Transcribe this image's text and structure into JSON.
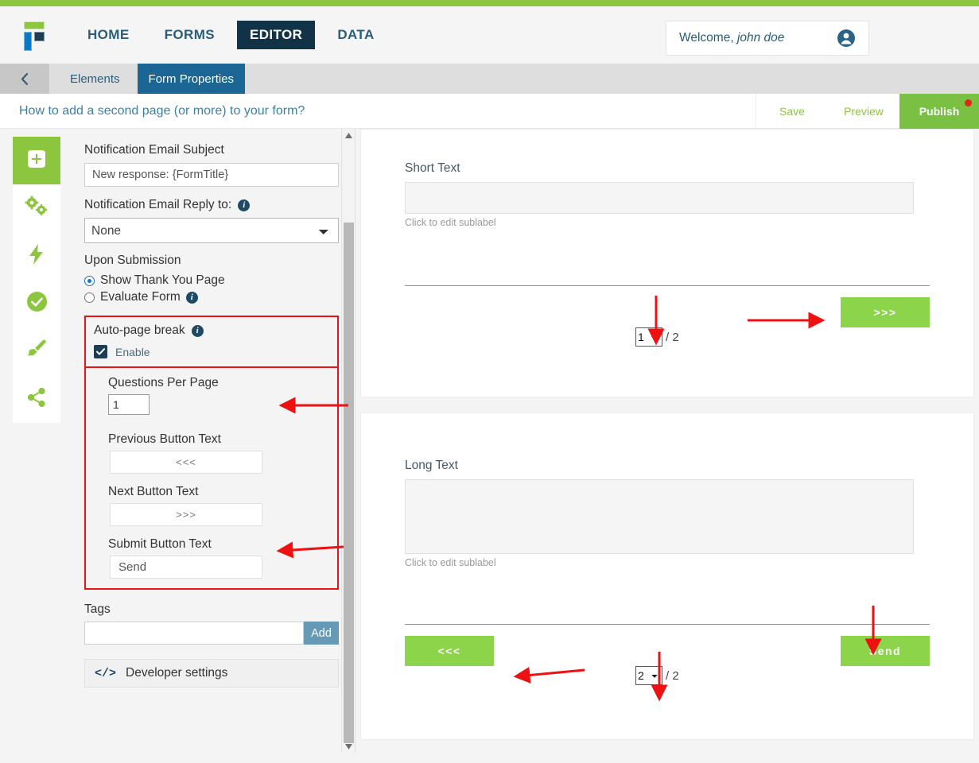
{
  "nav": {
    "logo_name": "formsite-logo",
    "links": [
      {
        "label": "HOME",
        "active": false
      },
      {
        "label": "FORMS",
        "active": false
      },
      {
        "label": "EDITOR",
        "active": true
      },
      {
        "label": "DATA",
        "active": false
      }
    ],
    "welcome_prefix": "Welcome,",
    "welcome_user": "john doe"
  },
  "subbar": {
    "back_icon": "chevron-left-icon",
    "tabs": [
      {
        "label": "Elements",
        "active": false
      },
      {
        "label": "Form Properties",
        "active": true
      }
    ]
  },
  "titlebar": {
    "form_title": "How to add a second page (or more) to your form?",
    "save_label": "Save",
    "preview_label": "Preview",
    "publish_label": "Publish"
  },
  "rail": {
    "items": [
      {
        "icon": "plus-square-icon",
        "active": true
      },
      {
        "icon": "gears-icon",
        "active": false
      },
      {
        "icon": "lightning-bolt-icon",
        "active": false
      },
      {
        "icon": "check-circle-icon",
        "active": false
      },
      {
        "icon": "paintbrush-icon",
        "active": false
      },
      {
        "icon": "share-nodes-icon",
        "active": false
      }
    ]
  },
  "properties": {
    "notification_subject_label": "Notification Email Subject",
    "notification_subject_value": "New response: {FormTitle}",
    "reply_to_label": "Notification Email Reply to:",
    "reply_to_value": "None",
    "reply_to_options": [
      "None"
    ],
    "upon_submission_label": "Upon Submission",
    "radio_thank_you": "Show Thank You Page",
    "radio_evaluate": "Evaluate Form",
    "auto_page_break_label": "Auto-page break",
    "enable_label": "Enable",
    "enable_checked": true,
    "questions_per_page_label": "Questions Per Page",
    "questions_per_page_value": "1",
    "previous_button_label": "Previous Button Text",
    "previous_button_value": "<<<",
    "next_button_label": "Next Button Text",
    "next_button_value": ">>>",
    "submit_button_label": "Submit Button Text",
    "submit_button_value": "Send",
    "tags_label": "Tags",
    "tags_value": "",
    "tags_add_label": "Add",
    "developer_settings_label": "Developer settings",
    "developer_settings_icon": "code-icon"
  },
  "preview": {
    "page1": {
      "field_label": "Short Text",
      "sublabel": "Click to edit sublabel",
      "next_button": ">>>",
      "page_current": "1",
      "page_total": "/ 2",
      "page_options": [
        "1",
        "2"
      ]
    },
    "page2": {
      "field_label": "Long Text",
      "sublabel": "Click to edit sublabel",
      "prev_button": "<<<",
      "submit_button": "Send",
      "page_current": "2",
      "page_total": "/ 2",
      "page_options": [
        "1",
        "2"
      ]
    }
  },
  "colors": {
    "brand_green": "#8cc63f",
    "button_green": "#8cd44a",
    "nav_dark": "#123347",
    "tab_blue": "#1b6694",
    "annotation_red": "#ee1111",
    "publish_dot_red": "#e8231a"
  }
}
